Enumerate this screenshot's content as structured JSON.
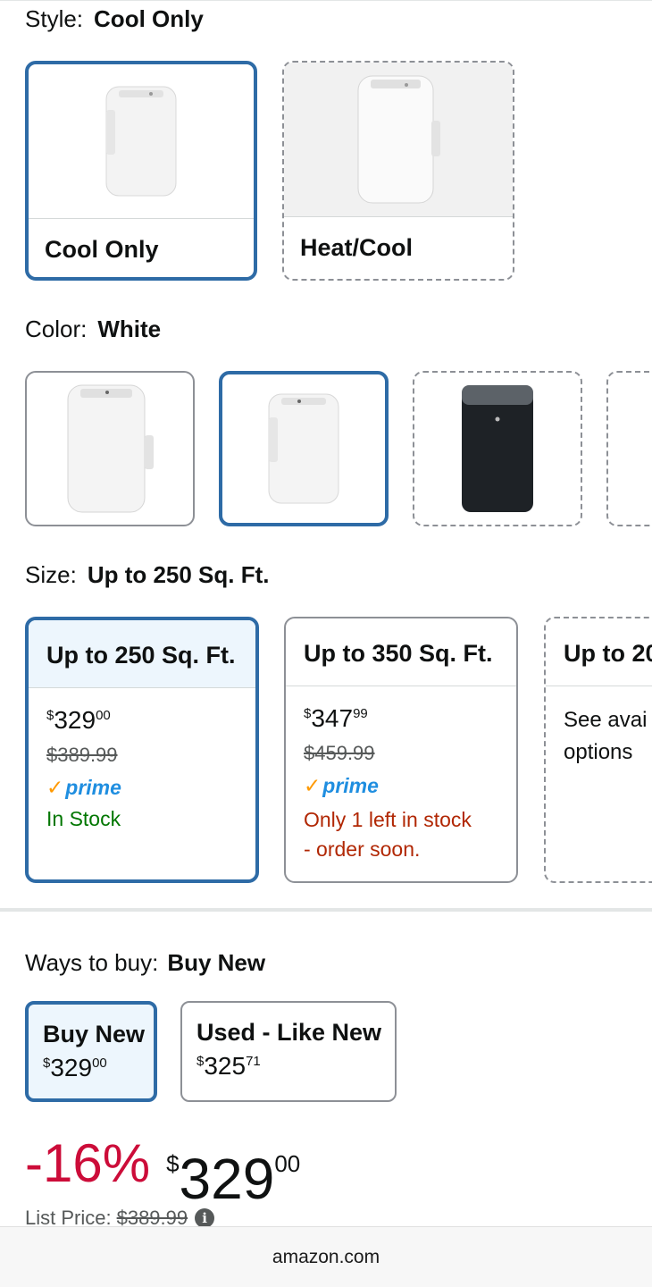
{
  "style": {
    "label": "Style:",
    "selected": "Cool Only",
    "options": [
      {
        "label": "Cool Only"
      },
      {
        "label": "Heat/Cool"
      }
    ]
  },
  "color": {
    "label": "Color:",
    "selected": "White",
    "swatches": [
      "white-ac-unit",
      "white-ac-unit-selected",
      "black-ac-unit",
      "partial-ac-unit"
    ]
  },
  "size": {
    "label": "Size:",
    "selected": "Up to 250 Sq. Ft.",
    "options": [
      {
        "title": "Up to 250 Sq. Ft.",
        "dollar": "$",
        "whole": "329",
        "cents": "00",
        "list": "$389.99",
        "prime": "prime",
        "stock": "In Stock"
      },
      {
        "title": "Up to 350 Sq. Ft.",
        "dollar": "$",
        "whole": "347",
        "cents": "99",
        "list": "$459.99",
        "prime": "prime",
        "stock_line1": "Only 1 left in stock",
        "stock_line2": "- order soon."
      },
      {
        "title": "Up to 20",
        "see_line1": "See avai",
        "see_line2": "options"
      }
    ]
  },
  "ways": {
    "label": "Ways to buy:",
    "selected": "Buy New",
    "options": [
      {
        "title": "Buy New",
        "dollar": "$",
        "whole": "329",
        "cents": "00"
      },
      {
        "title": "Used - Like New",
        "dollar": "$",
        "whole": "325",
        "cents": "71"
      }
    ]
  },
  "price": {
    "discount": "-16%",
    "dollar": "$",
    "whole": "329",
    "cents": "00",
    "list_label": "List Price:",
    "list_value": "$389.99"
  },
  "footer": {
    "domain": "amazon.com"
  },
  "colors": {
    "selected_border": "#2e6ba6",
    "deal_red": "#cc0c39",
    "in_stock_green": "#007600",
    "low_stock_red": "#b12704",
    "prime_blue": "#1f8ee0"
  }
}
